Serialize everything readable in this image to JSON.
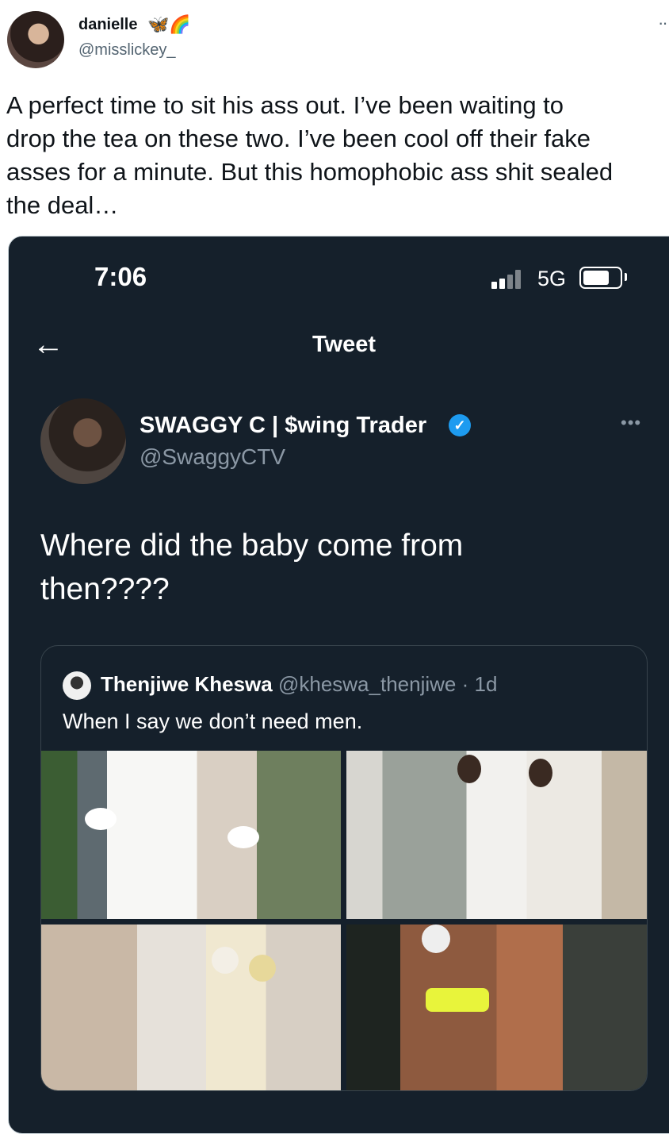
{
  "author": {
    "name": "danielle",
    "emoji": "🦋🌈",
    "handle": "@misslickey_",
    "more": "··"
  },
  "tweet_lines": [
    "A perfect time to sit his ass out. I’ve been waiting to",
    "drop the tea on these two. I’ve been cool off their fake",
    "asses for a minute. But this homophobic ass shit sealed",
    "the deal…"
  ],
  "screenshot": {
    "status_time": "7:06",
    "network": "5G",
    "nav_title": "Tweet",
    "back_icon": "←",
    "quoted_tweet": {
      "name": "SWAGGY C | $wing Trader",
      "verified_mark": "✓",
      "handle": "@SwaggyCTV",
      "more": "•••",
      "text_lines": [
        "Where did the baby come from",
        "then????"
      ],
      "embedded": {
        "name": "Thenjiwe Kheswa",
        "handle": "@kheswa_thenjiwe",
        "time": "· 1d",
        "text": "When I say we don’t need men."
      }
    }
  },
  "colors": {
    "dark_bg": "#15202b",
    "verified_blue": "#1d9bf0",
    "muted": "#8b98a5"
  }
}
